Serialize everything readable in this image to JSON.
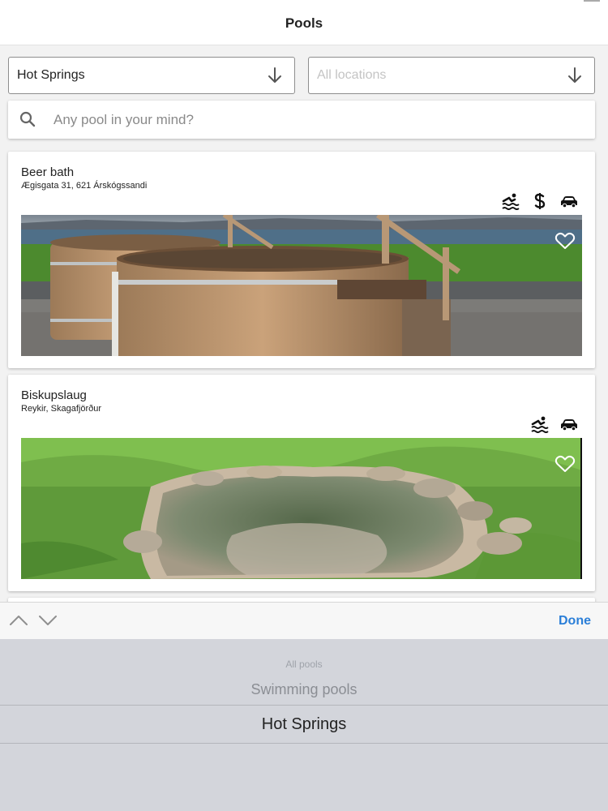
{
  "nav": {
    "title": "Pools"
  },
  "filters": {
    "type": {
      "value": "Hot Springs"
    },
    "location": {
      "placeholder": "All locations"
    }
  },
  "search": {
    "placeholder": "Any pool in your mind?"
  },
  "pools": [
    {
      "name": "Beer bath",
      "address": "Ægisgata 31, 621 Árskógssandi",
      "features": [
        "swimming-icon",
        "dollar-icon",
        "car-icon"
      ]
    },
    {
      "name": "Biskupslaug",
      "address": "Reykir, Skagafjörður",
      "features": [
        "swimming-icon",
        "car-icon"
      ]
    }
  ],
  "toolbar": {
    "done_label": "Done"
  },
  "picker": {
    "options": [
      "All pools",
      "Swimming pools",
      "Hot Springs"
    ],
    "selected": "Hot Springs"
  },
  "colors": {
    "accent": "#2b7fd8",
    "picker_bg": "#d3d5db"
  }
}
